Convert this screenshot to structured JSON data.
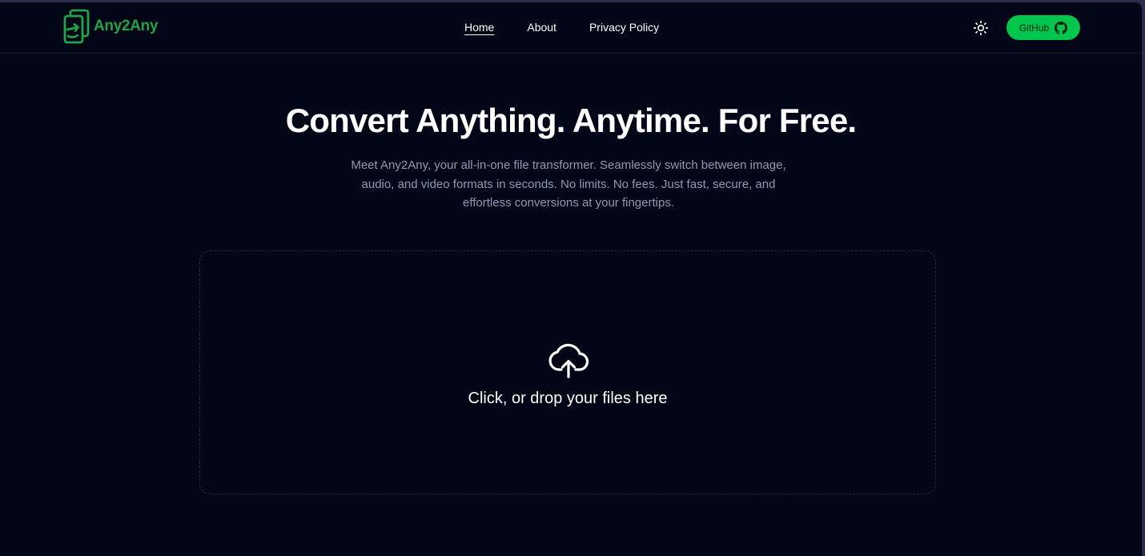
{
  "brand": {
    "name": "Any2Any",
    "color": "#23a34a"
  },
  "nav": {
    "items": [
      {
        "label": "Home",
        "active": true
      },
      {
        "label": "About",
        "active": false
      },
      {
        "label": "Privacy Policy",
        "active": false
      }
    ]
  },
  "header": {
    "theme_toggle_icon": "sun-icon",
    "github_label": "GitHub",
    "github_icon": "github-icon",
    "github_color": "#00c64e"
  },
  "hero": {
    "title": "Convert Anything. Anytime. For Free.",
    "subtitle": "Meet Any2Any, your all-in-one file transformer. Seamlessly switch between image, audio, and video formats in seconds. No limits. No fees. Just fast, secure, and effortless conversions at your fingertips."
  },
  "dropzone": {
    "icon": "cloud-upload-icon",
    "text": "Click, or drop your files here"
  },
  "colors": {
    "background": "#020617",
    "text": "#ffffff",
    "muted_text": "#8f9bb0"
  }
}
